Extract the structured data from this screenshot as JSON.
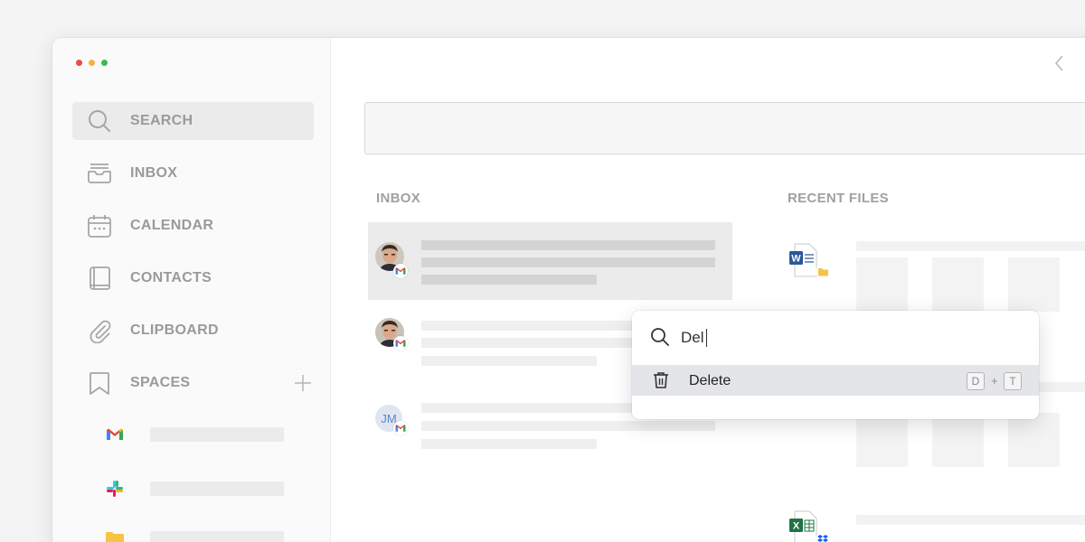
{
  "sidebar": {
    "items": [
      {
        "label": "SEARCH",
        "icon": "search-icon",
        "active": true
      },
      {
        "label": "INBOX",
        "icon": "inbox-icon"
      },
      {
        "label": "CALENDAR",
        "icon": "calendar-icon"
      },
      {
        "label": "CONTACTS",
        "icon": "contacts-icon"
      },
      {
        "label": "CLIPBOARD",
        "icon": "paperclip-icon"
      },
      {
        "label": "SPACES",
        "icon": "bookmark-icon"
      }
    ],
    "spaces": [
      {
        "icon": "gmail-icon"
      },
      {
        "icon": "slack-icon"
      },
      {
        "icon": "folder-icon"
      }
    ]
  },
  "main": {
    "inbox_title": "INBOX",
    "recent_files_title": "RECENT FILES",
    "emails": [
      {
        "avatar": "photo",
        "badge": "gmail-icon",
        "selected": true
      },
      {
        "avatar": "photo",
        "badge": "gmail-icon"
      },
      {
        "avatar_initials": "JM",
        "badge": "gmail-icon"
      }
    ],
    "files": [
      {
        "icon": "word-file-icon",
        "badge": "folder-icon"
      },
      {
        "icon": "excel-file-icon",
        "badge": "dropbox-icon"
      }
    ]
  },
  "palette": {
    "query": "Del",
    "results": [
      {
        "label": "Delete",
        "icon": "trash-icon",
        "shortcut": [
          "D",
          "+",
          "T"
        ]
      }
    ]
  },
  "colors": {
    "accent_red": "#ed4a46",
    "accent_yellow": "#f3b43b",
    "accent_green": "#3dba4e",
    "selection": "#e3e5e9"
  }
}
